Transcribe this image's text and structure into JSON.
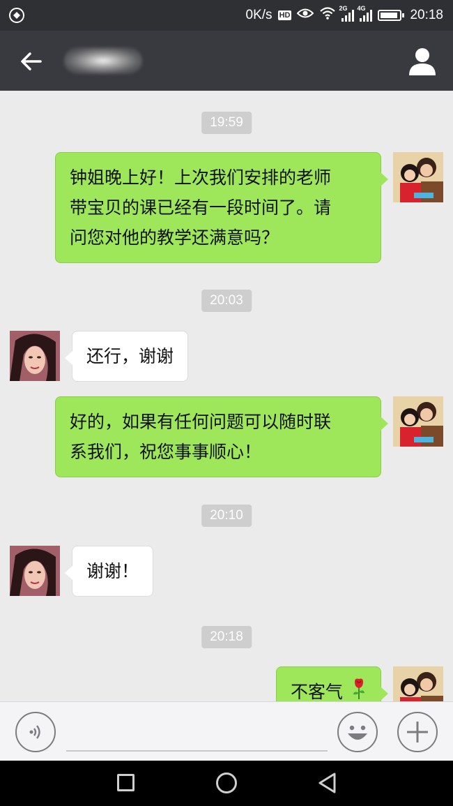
{
  "status_bar": {
    "net_speed": "0K/s",
    "hd_badge": "HD",
    "sig1_label": "2G",
    "sig2_label": "4G",
    "time": "20:18"
  },
  "header": {
    "contact_name_blurred": true
  },
  "messages": [
    {
      "type": "time",
      "text": "19:59"
    },
    {
      "type": "sent",
      "lines": [
        "钟姐晚上好！上次我们安排的老师",
        "带宝贝的课已经有一段时间了。请",
        "问您对他的教学还满意吗？"
      ]
    },
    {
      "type": "time",
      "text": "20:03"
    },
    {
      "type": "received",
      "text": "还行，谢谢"
    },
    {
      "type": "sent",
      "lines": [
        "好的，如果有任何问题可以随时联",
        "系我们，祝您事事顺心！"
      ]
    },
    {
      "type": "time",
      "text": "20:10"
    },
    {
      "type": "received",
      "text": "谢谢！"
    },
    {
      "type": "time",
      "text": "20:18"
    },
    {
      "type": "sent",
      "lines": [
        "不客气"
      ],
      "emoji": "rose"
    }
  ],
  "colors": {
    "sent_bubble": "#9fe75a",
    "received_bubble": "#ffffff",
    "chat_bg": "#ebebeb",
    "title_bar": "#393a3f"
  }
}
